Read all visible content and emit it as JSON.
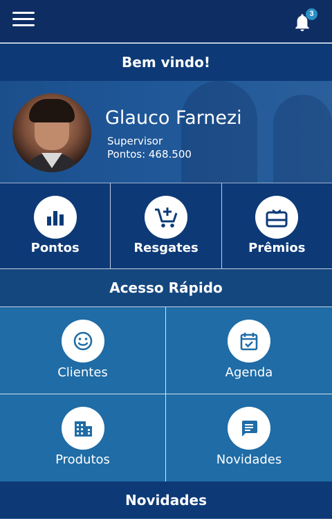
{
  "header": {
    "menu_icon": "hamburger-menu-icon",
    "notifications_icon": "bell-icon",
    "notification_count": "3"
  },
  "welcome": {
    "text": "Bem vindo!"
  },
  "profile": {
    "name": "Glauco Farnezi",
    "role": "Supervisor",
    "points": "Pontos: 468.500"
  },
  "main_tiles": [
    {
      "label": "Pontos",
      "icon": "bar-chart-icon"
    },
    {
      "label": "Resgates",
      "icon": "cart-add-icon"
    },
    {
      "label": "Prêmios",
      "icon": "gift-card-icon"
    }
  ],
  "quick_access": {
    "title": "Acesso Rápido",
    "items": [
      {
        "label": "Clientes",
        "icon": "smiley-icon"
      },
      {
        "label": "Agenda",
        "icon": "calendar-check-icon"
      },
      {
        "label": "Produtos",
        "icon": "building-icon"
      },
      {
        "label": "Novidades",
        "icon": "chat-message-icon"
      }
    ]
  },
  "news_section": {
    "title": "Novidades"
  },
  "colors": {
    "header": "#0d2d63",
    "band": "#0d3a77",
    "quick_tiles": "#1f6ca6",
    "badge": "#2a8fc4"
  }
}
